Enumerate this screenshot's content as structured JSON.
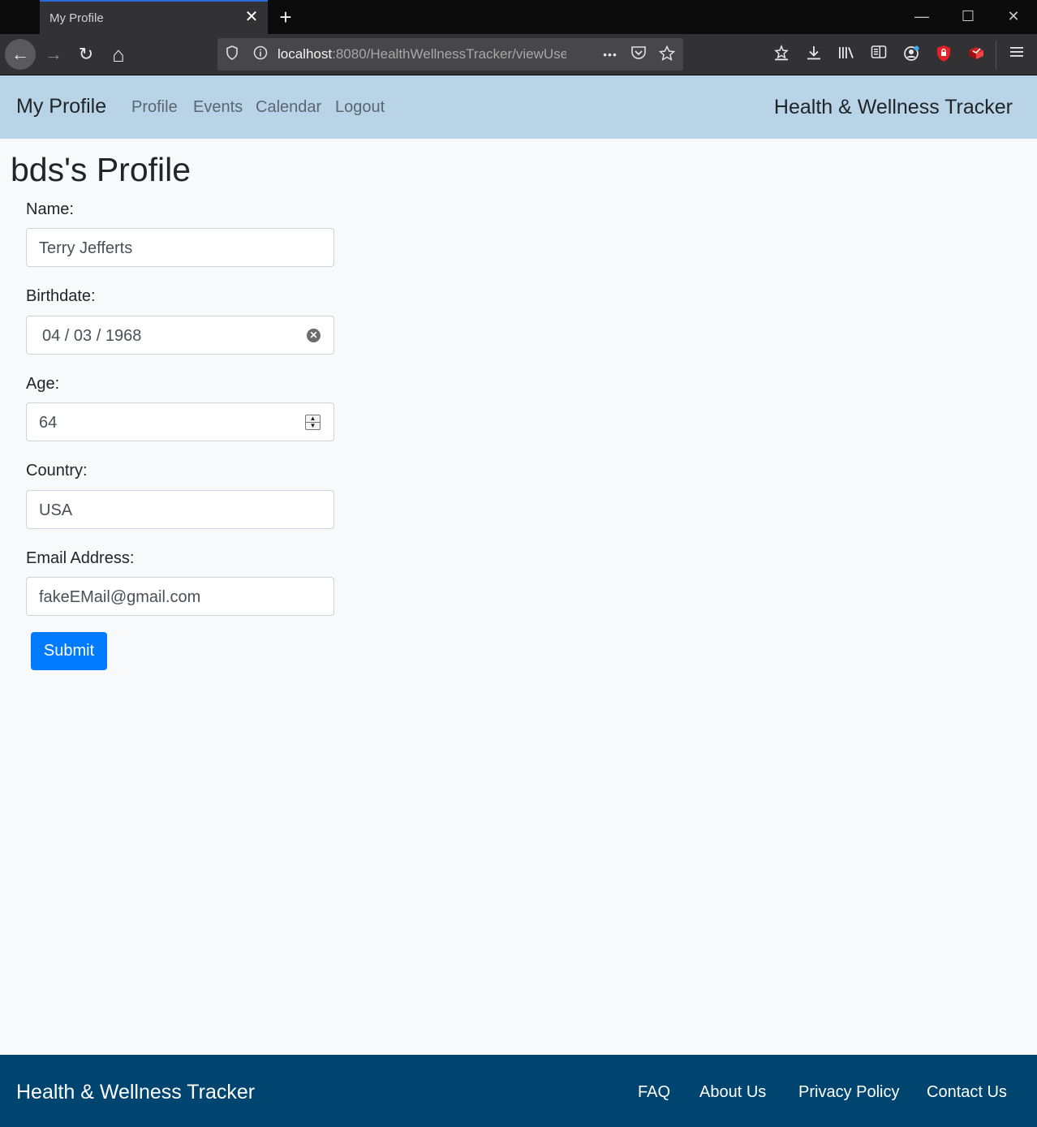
{
  "browser": {
    "tab_title": "My Profile",
    "tab_close": "✕",
    "new_tab": "+",
    "window_controls": {
      "minimize": "—",
      "maximize": "☐",
      "close": "✕"
    },
    "nav": {
      "back": "←",
      "forward": "→",
      "reload": "↻",
      "home": "⌂"
    },
    "url_host": "localhost",
    "url_rest": ":8080/HealthWellnessTracker/viewUse",
    "url_more": "•••",
    "toolbar_icons": [
      "shield-icon",
      "info-icon",
      "pocket-icon",
      "star-icon",
      "bookmarks-icon",
      "download-icon",
      "library-icon",
      "sidebar-icon",
      "account-icon",
      "addon-shield-icon",
      "addon-icon",
      "menu-icon"
    ]
  },
  "navbar": {
    "brand": "My Profile",
    "links": [
      "Profile",
      "Events",
      "Calendar",
      "Logout"
    ],
    "right_title": "Health & Wellness Tracker",
    "bg_color": "#bad4e7"
  },
  "main": {
    "title": "bds's Profile",
    "fields": {
      "name": {
        "label": "Name:",
        "value": "Terry Jefferts"
      },
      "birthdate": {
        "label": "Birthdate:",
        "value": "04 / 03 / 1968"
      },
      "age": {
        "label": "Age:",
        "value": "64"
      },
      "country": {
        "label": "Country:",
        "value": "USA"
      },
      "email": {
        "label": "Email Address:",
        "value": "fakeEMail@gmail.com"
      }
    },
    "submit_label": "Submit",
    "accent_color": "#007bff"
  },
  "footer": {
    "brand": "Health & Wellness Tracker",
    "links": [
      "FAQ",
      "About Us",
      "Privacy Policy",
      "Contact Us"
    ],
    "bg_color": "#004570"
  }
}
